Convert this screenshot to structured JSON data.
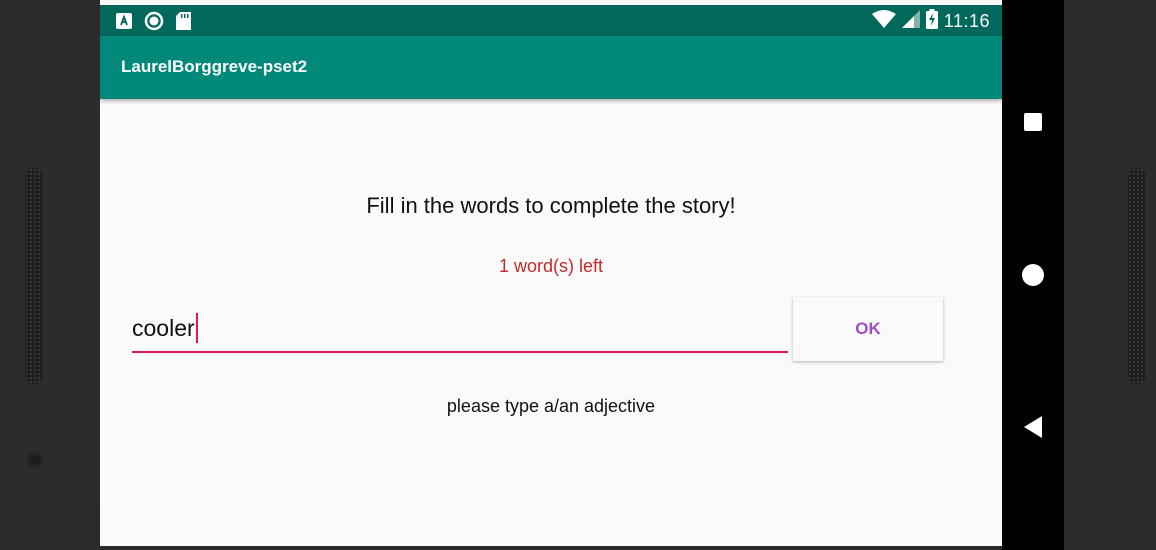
{
  "status_bar": {
    "time": "11:16",
    "left_icons": [
      "a-box-icon",
      "record-icon",
      "sd-card-icon"
    ],
    "right_icons": [
      "wifi-icon",
      "cell-signal-icon",
      "battery-charging-icon"
    ]
  },
  "app_bar": {
    "title": "LaurelBorggreve-pset2"
  },
  "main": {
    "instruction": "Fill in the words to complete the story!",
    "words_left": "1 word(s) left",
    "input_value": "cooler",
    "ok_label": "OK",
    "hint": "please type a/an adjective"
  },
  "nav_bar": {
    "buttons": [
      "recents-square-icon",
      "home-circle-icon",
      "back-triangle-icon"
    ]
  },
  "colors": {
    "status_bar": "#00695c",
    "app_bar": "#00897b",
    "accent": "#d81b60",
    "words_left": "#c62828",
    "button_text": "#9c4dcc"
  }
}
